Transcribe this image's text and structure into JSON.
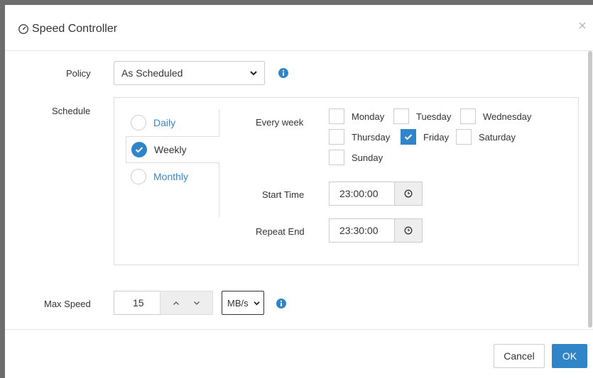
{
  "dialog": {
    "title": "Speed Controller",
    "title_icon": "speedometer-icon",
    "close_icon": "close-icon"
  },
  "policy": {
    "label": "Policy",
    "value": "As Scheduled",
    "info_icon": "info-icon"
  },
  "schedule": {
    "label": "Schedule",
    "tabs": [
      {
        "label": "Daily",
        "selected": false
      },
      {
        "label": "Weekly",
        "selected": true
      },
      {
        "label": "Monthly",
        "selected": false
      }
    ],
    "every_week_label": "Every week",
    "days": [
      {
        "label": "Monday",
        "checked": false
      },
      {
        "label": "Tuesday",
        "checked": false
      },
      {
        "label": "Wednesday",
        "checked": false
      },
      {
        "label": "Thursday",
        "checked": false
      },
      {
        "label": "Friday",
        "checked": true
      },
      {
        "label": "Saturday",
        "checked": false
      },
      {
        "label": "Sunday",
        "checked": false
      }
    ],
    "start_time": {
      "label": "Start Time",
      "value": "23:00:00"
    },
    "repeat_end": {
      "label": "Repeat End",
      "value": "23:30:00"
    }
  },
  "max_speed": {
    "label": "Max Speed",
    "value": "15",
    "unit": "MB/s"
  },
  "footer": {
    "cancel_label": "Cancel",
    "ok_label": "OK"
  },
  "colors": {
    "accent": "#2f85c8",
    "link": "#3a88c9",
    "backdrop": "#6d6d6d"
  }
}
